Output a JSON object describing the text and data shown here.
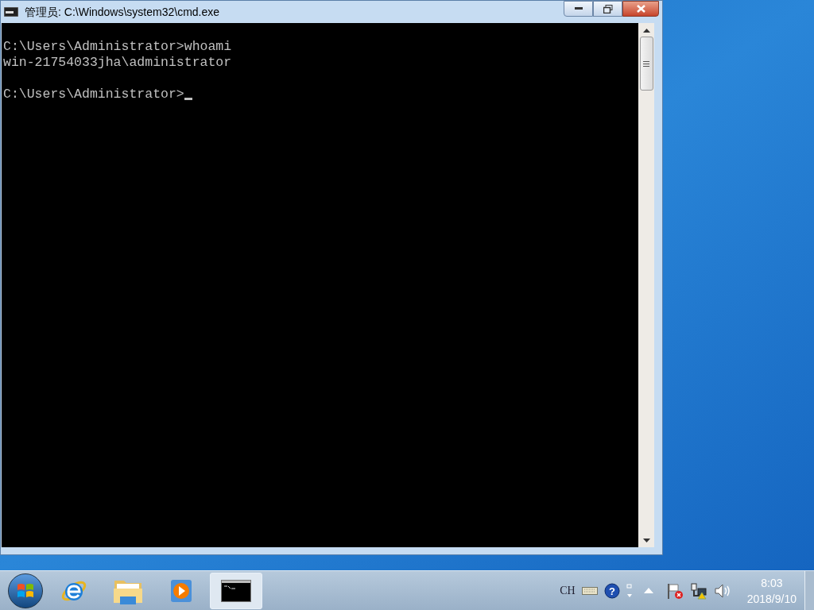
{
  "window": {
    "title": "管理员: C:\\Windows\\system32\\cmd.exe"
  },
  "console": {
    "lines": [
      {
        "kind": "blank"
      },
      {
        "kind": "text",
        "text": "C:\\Users\\Administrator>whoami",
        "cursor": false
      },
      {
        "kind": "text",
        "text": "win-21754033jha\\administrator",
        "cursor": false
      },
      {
        "kind": "blank"
      },
      {
        "kind": "text",
        "text": "C:\\Users\\Administrator>",
        "cursor": true
      }
    ]
  },
  "taskbar": {
    "items": [
      {
        "kind": "ie",
        "selected": false
      },
      {
        "kind": "explorer",
        "selected": false
      },
      {
        "kind": "media",
        "selected": false
      },
      {
        "kind": "cmd",
        "selected": true
      }
    ]
  },
  "tray": {
    "language": "CH",
    "help_symbol": "?",
    "time": "8:03",
    "date": "2018/9/10"
  }
}
